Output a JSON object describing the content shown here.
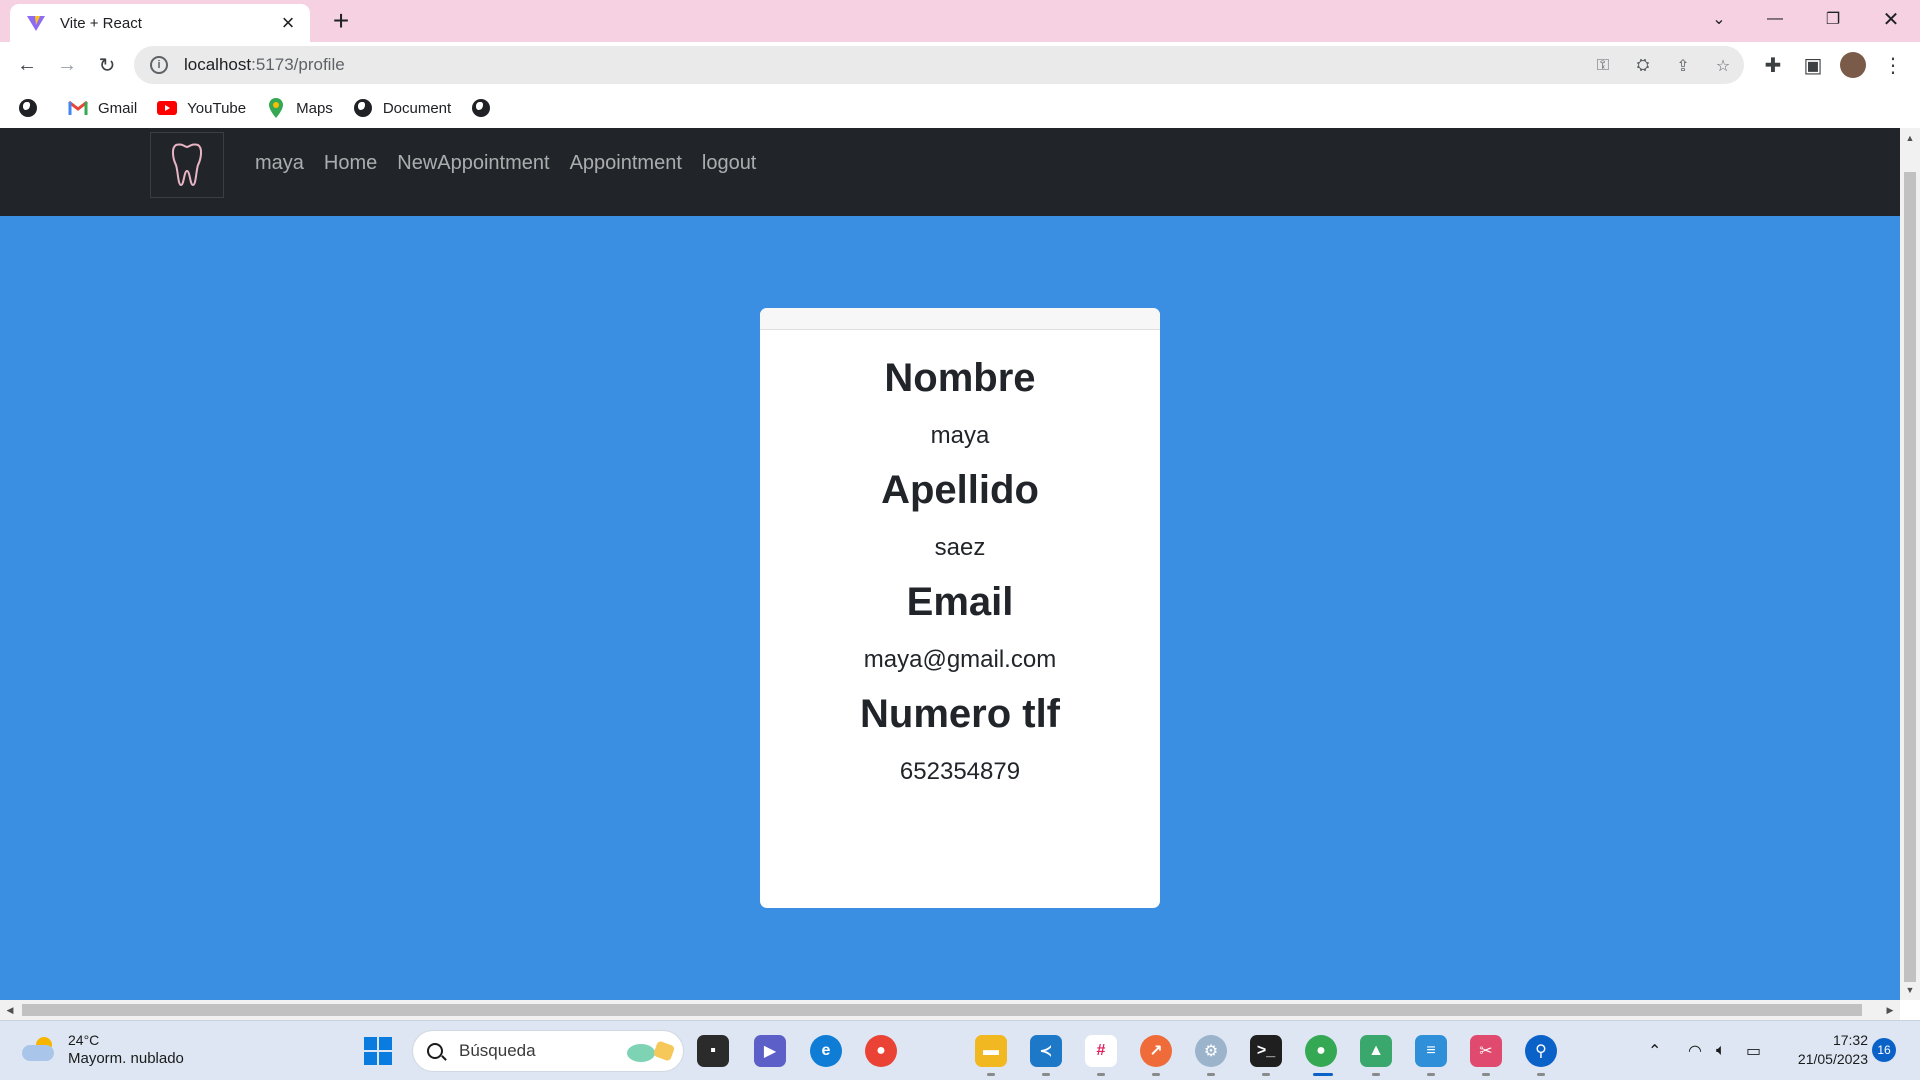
{
  "browser": {
    "tab_title": "Vite + React",
    "url_host": "localhost",
    "url_rest": ":5173/profile",
    "bookmarks": [
      "Gmail",
      "YouTube",
      "Maps",
      "Document"
    ]
  },
  "navbar": {
    "links": [
      "maya",
      "Home",
      "NewAppointment",
      "Appointment",
      "logout"
    ]
  },
  "profile": {
    "name_label": "Nombre",
    "name_value": "maya",
    "surname_label": "Apellido",
    "surname_value": "saez",
    "email_label": "Email",
    "email_value": "maya@gmail.com",
    "phone_label": "Numero tlf",
    "phone_value": "652354879"
  },
  "taskbar": {
    "temperature": "24°C",
    "weather": "Mayorm. nublado",
    "search_label": "Búsqueda",
    "time": "17:32",
    "date": "21/05/2023",
    "notifications": "16"
  },
  "colors": {
    "page_background": "#3b8fe3",
    "navbar": "#212529",
    "tab_strip": "#f6d1e1"
  }
}
